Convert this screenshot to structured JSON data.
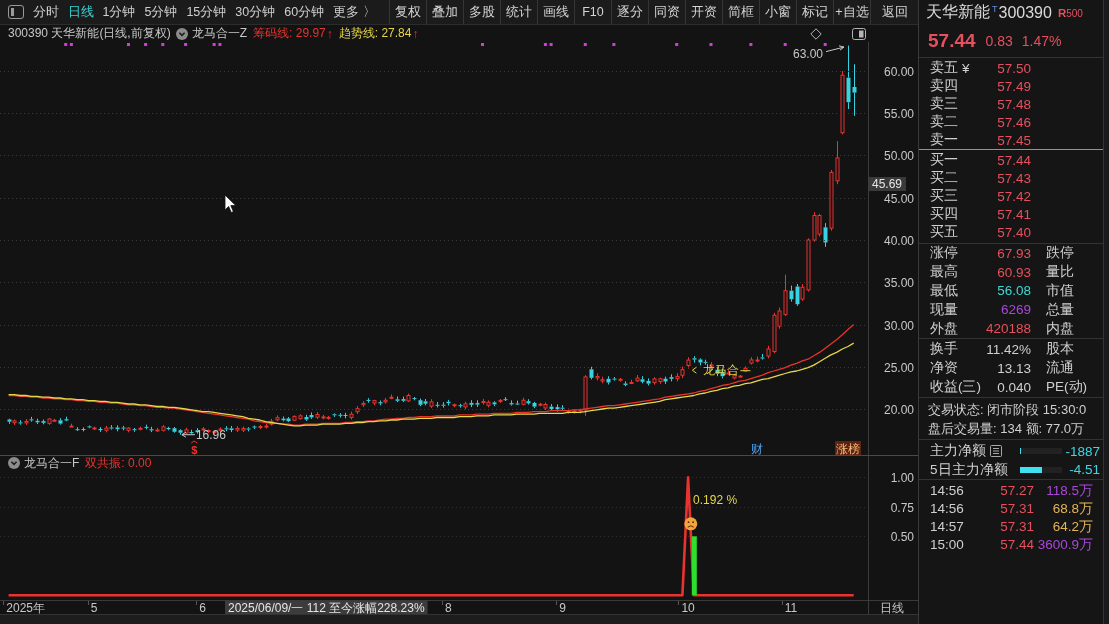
{
  "toolbar": {
    "tabs": [
      {
        "label": "分时",
        "selected": false
      },
      {
        "label": "日线",
        "selected": true
      },
      {
        "label": "1分钟",
        "selected": false
      },
      {
        "label": "5分钟",
        "selected": false
      },
      {
        "label": "15分钟",
        "selected": false
      },
      {
        "label": "30分钟",
        "selected": false
      },
      {
        "label": "60分钟",
        "selected": false
      },
      {
        "label": "更多 〉",
        "selected": false
      }
    ],
    "buttons": [
      "复权",
      "叠加",
      "多股",
      "统计",
      "画线",
      "F10",
      "逐分",
      "同资",
      "开资",
      "简框",
      "小窗",
      "标记",
      "+自选"
    ],
    "back": "返回"
  },
  "chart_header": {
    "title": "300390 天华新能(日线,前复权)",
    "indicator": "龙马合一Z",
    "legend": [
      {
        "label": "筹码线:",
        "value": "29.97",
        "arrow": "↑",
        "color": "#e8332e"
      },
      {
        "label": "趋势线:",
        "value": "27.84",
        "arrow": "↑",
        "color": "#e6d64a"
      }
    ]
  },
  "price_chart": {
    "cursor_value": "45.69",
    "high_label": "63.00",
    "low_label": "16.96",
    "signal_label": "龙马合",
    "event_marks": [
      {
        "kind": "dividend",
        "text": "$"
      },
      {
        "kind": "finance",
        "text": "财"
      },
      {
        "kind": "rank",
        "text": "涨榜"
      }
    ],
    "chart_data": {
      "type": "line",
      "grid": true,
      "categories": [
        null,
        null,
        null,
        null,
        null,
        null,
        null,
        null,
        null,
        null,
        null,
        null,
        null,
        null,
        null,
        null,
        null,
        null,
        null,
        null,
        null,
        null,
        null,
        null,
        null,
        null,
        null,
        null,
        null,
        null,
        null,
        null,
        null,
        null,
        null,
        null,
        null,
        null,
        null,
        null,
        null,
        null,
        null,
        null,
        null,
        null,
        null,
        null,
        null,
        null,
        null,
        null,
        null,
        null,
        null,
        null,
        null,
        null,
        null,
        null,
        null,
        null,
        null,
        null,
        null,
        null,
        null,
        null,
        null,
        null,
        null,
        null,
        null,
        null,
        null,
        null,
        null,
        null,
        null,
        null,
        null,
        null,
        null,
        null,
        null,
        null,
        null,
        null,
        null,
        null,
        null,
        null,
        null,
        null,
        null,
        null,
        null,
        null,
        null,
        null,
        null,
        null,
        null,
        null,
        null,
        null,
        null,
        null,
        null,
        null,
        null,
        null,
        null,
        null,
        null,
        null,
        null,
        null,
        null,
        null,
        null,
        null,
        null,
        null,
        null,
        null,
        null,
        null,
        null,
        null,
        null,
        null,
        null,
        null,
        null,
        null,
        null,
        null,
        null,
        null,
        null,
        null,
        null,
        null,
        null,
        null,
        null,
        null,
        null,
        null,
        null,
        null
      ],
      "ylim": [
        14.56,
        63.43
      ],
      "yticks": [
        {
          "value": 20,
          "label": "20.00"
        },
        {
          "value": 25,
          "label": "25.00"
        },
        {
          "value": 30,
          "label": "30.00"
        },
        {
          "value": 35,
          "label": "35.00"
        },
        {
          "value": 40,
          "label": "40.00"
        },
        {
          "value": 45,
          "label": "45.00"
        },
        {
          "value": 50,
          "label": "50.00"
        },
        {
          "value": 55,
          "label": "55.00"
        },
        {
          "value": 60,
          "label": "60.00"
        }
      ],
      "series": [
        {
          "color": "#e8332e",
          "values": [
            null,
            21.6,
            21.6,
            21.5,
            21.5,
            21.4,
            21.4,
            21.3,
            21.3,
            21.2,
            21.2,
            21.1,
            21.1,
            21.0,
            21.0,
            20.9,
            20.9,
            20.8,
            20.8,
            20.7,
            20.7,
            20.6,
            20.5,
            20.5,
            20.4,
            20.4,
            20.3,
            20.2,
            20.2,
            20.1,
            20.1,
            20.0,
            19.9,
            19.8,
            19.7,
            19.6,
            19.5,
            19.4,
            19.3,
            19.2,
            19.1,
            19.0,
            18.9,
            18.8,
            18.6,
            18.5,
            18.4,
            18.3,
            18.3,
            18.2,
            18.2,
            18.1,
            18.1,
            18.2,
            18.2,
            18.2,
            18.3,
            18.3,
            18.3,
            18.3,
            18.4,
            18.4,
            18.5,
            18.5,
            18.6,
            18.6,
            18.7,
            18.8,
            18.8,
            18.9,
            18.9,
            19.0,
            19.0,
            19.1,
            19.1,
            19.1,
            19.2,
            19.2,
            19.2,
            19.2,
            19.3,
            19.3,
            19.3,
            19.4,
            19.4,
            19.4,
            19.5,
            19.5,
            19.5,
            19.5,
            19.6,
            19.6,
            19.6,
            19.7,
            19.7,
            19.7,
            19.8,
            19.8,
            19.8,
            19.8,
            19.9,
            19.9,
            20.0,
            20.1,
            20.2,
            20.3,
            20.4,
            20.4,
            20.5,
            20.6,
            20.7,
            20.8,
            20.9,
            21.0,
            21.1,
            21.2,
            21.4,
            21.5,
            21.6,
            21.7,
            21.8,
            21.9,
            22.1,
            22.2,
            22.4,
            22.6,
            22.8,
            22.9,
            23.1,
            23.3,
            23.4,
            23.6,
            23.8,
            24.0,
            24.3,
            24.5,
            24.7,
            24.9,
            25.2,
            25.4,
            25.7,
            25.9,
            26.3,
            26.7,
            27.2,
            27.7,
            28.2,
            28.8,
            29.4,
            30.0,
            null,
            null
          ]
        },
        {
          "color": "#e6d64a",
          "values": [
            null,
            21.7,
            21.7,
            21.6,
            21.6,
            21.5,
            21.5,
            21.4,
            21.4,
            21.3,
            21.3,
            21.2,
            21.2,
            21.1,
            21.1,
            21.0,
            21.0,
            20.9,
            20.9,
            20.8,
            20.8,
            20.7,
            20.6,
            20.6,
            20.5,
            20.5,
            20.4,
            20.3,
            20.3,
            20.2,
            20.2,
            20.1,
            20.0,
            19.9,
            19.8,
            19.7,
            19.7,
            19.6,
            19.5,
            19.4,
            19.3,
            19.2,
            19.1,
            18.9,
            18.8,
            18.7,
            18.5,
            18.4,
            18.3,
            18.2,
            18.1,
            18.0,
            18.0,
            18.1,
            18.1,
            18.1,
            18.2,
            18.2,
            18.2,
            18.2,
            18.3,
            18.3,
            18.4,
            18.4,
            18.5,
            18.5,
            18.6,
            18.6,
            18.7,
            18.7,
            18.8,
            18.8,
            18.8,
            18.9,
            18.9,
            18.9,
            19.0,
            19.0,
            19.0,
            19.0,
            19.1,
            19.1,
            19.1,
            19.2,
            19.2,
            19.2,
            19.3,
            19.3,
            19.3,
            19.3,
            19.4,
            19.4,
            19.4,
            19.4,
            19.5,
            19.5,
            19.5,
            19.5,
            19.5,
            19.6,
            19.6,
            19.6,
            19.7,
            19.8,
            19.9,
            20.0,
            20.1,
            20.1,
            20.2,
            20.3,
            20.4,
            20.5,
            20.6,
            20.7,
            20.8,
            20.9,
            21.1,
            21.2,
            21.3,
            21.4,
            21.5,
            21.6,
            21.8,
            21.9,
            22.1,
            22.2,
            22.4,
            22.5,
            22.7,
            22.8,
            23.0,
            23.1,
            23.3,
            23.5,
            23.6,
            23.8,
            24.0,
            24.2,
            24.4,
            24.5,
            24.7,
            24.9,
            25.2,
            25.6,
            26.0,
            26.4,
            26.7,
            27.1,
            27.4,
            27.8,
            null,
            null
          ]
        }
      ]
    }
  },
  "indicator": {
    "title": "龙马合一F",
    "reading": "双共振: 0.00",
    "cursor_date": "2025/06/09/一 112 至今涨幅228.23%",
    "period": "日线",
    "chart_data": {
      "type": "line",
      "grid": true,
      "categories": [
        null,
        null,
        null,
        null,
        "2025年",
        null,
        null,
        null,
        null,
        null,
        null,
        null,
        null,
        null,
        null,
        null,
        "5",
        null,
        null,
        null,
        null,
        null,
        null,
        null,
        null,
        null,
        null,
        null,
        null,
        null,
        null,
        null,
        null,
        null,
        null,
        "6",
        null,
        null,
        null,
        null,
        null,
        null,
        null,
        null,
        null,
        null,
        null,
        null,
        null,
        null,
        null,
        null,
        null,
        null,
        null,
        null,
        null,
        null,
        null,
        null,
        null,
        null,
        null,
        null,
        null,
        null,
        null,
        null,
        null,
        null,
        null,
        null,
        null,
        null,
        null,
        null,
        null,
        null,
        "8",
        null,
        null,
        null,
        null,
        null,
        null,
        null,
        null,
        null,
        null,
        null,
        null,
        null,
        null,
        null,
        null,
        null,
        null,
        null,
        "9",
        null,
        null,
        null,
        null,
        null,
        null,
        null,
        null,
        null,
        null,
        null,
        null,
        null,
        null,
        null,
        null,
        null,
        null,
        null,
        null,
        null,
        "10",
        null,
        null,
        null,
        null,
        null,
        null,
        null,
        null,
        null,
        null,
        null,
        null,
        null,
        null,
        null,
        null,
        null,
        "11",
        null,
        null,
        null,
        null,
        null,
        null,
        null,
        null,
        null,
        null,
        null,
        null,
        null
      ],
      "ylim": [
        -0.04,
        1.18
      ],
      "yticks": [
        {
          "value": 0.5,
          "label": "0.50"
        },
        {
          "value": 0.75,
          "label": "0.75"
        },
        {
          "value": 1,
          "label": "1.00"
        }
      ],
      "series": [
        {
          "color": "#e8332e",
          "values": [
            null,
            0,
            0,
            0,
            0,
            0,
            0,
            0,
            0,
            0,
            0,
            0,
            0,
            0,
            0,
            0,
            0,
            0,
            0,
            0,
            0,
            0,
            0,
            0,
            0,
            0,
            0,
            0,
            0,
            0,
            0,
            0,
            0,
            0,
            0,
            0,
            0,
            0,
            0,
            0,
            0,
            0,
            0,
            0,
            0,
            0,
            0,
            0,
            0,
            0,
            0,
            0,
            0,
            0,
            0,
            0,
            0,
            0,
            0,
            0,
            0,
            0,
            0,
            0,
            0,
            0,
            0,
            0,
            0,
            0,
            0,
            0,
            0,
            0,
            0,
            0,
            0,
            0,
            0,
            0,
            0,
            0,
            0,
            0,
            0,
            0,
            0,
            0,
            0,
            0,
            0,
            0,
            0,
            0,
            0,
            0,
            0,
            0,
            0,
            0,
            0,
            0,
            0,
            0,
            0,
            0,
            0,
            0,
            0,
            0,
            0,
            0,
            0,
            0,
            0,
            0,
            0,
            0,
            0,
            0,
            1,
            0,
            0,
            0,
            0,
            0,
            0,
            0,
            0,
            0,
            0,
            0,
            0,
            0,
            0,
            0,
            0,
            0,
            0,
            0,
            0,
            0,
            0,
            0,
            0,
            0,
            0,
            0,
            0,
            0,
            null,
            null
          ]
        }
      ],
      "annotations": [
        "0.192 %"
      ]
    }
  },
  "quote": {
    "name": "天华新能",
    "tag": "T",
    "code": "300390",
    "rank": "**R**500",
    "price": "57.44",
    "change": "0.83",
    "change_pct": "1.47%",
    "asks": [
      {
        "label": "卖五",
        "mark": "¥",
        "price": "57.50"
      },
      {
        "label": "卖四",
        "price": "57.49"
      },
      {
        "label": "卖三",
        "price": "57.48"
      },
      {
        "label": "卖二",
        "price": "57.46"
      },
      {
        "label": "卖一",
        "price": "57.45"
      }
    ],
    "bids": [
      {
        "label": "买一",
        "price": "57.44"
      },
      {
        "label": "买二",
        "price": "57.43"
      },
      {
        "label": "买三",
        "price": "57.42"
      },
      {
        "label": "买四",
        "price": "57.41"
      },
      {
        "label": "买五",
        "price": "57.40"
      }
    ],
    "stats": [
      {
        "label": "涨停",
        "value": "67.93",
        "color": "#e5505e",
        "label_2": "跌停"
      },
      {
        "label": "最高",
        "value": "60.93",
        "color": "#e5505e",
        "label_2": "量比"
      },
      {
        "label": "最低",
        "value": "56.08",
        "color": "#3fd6d6",
        "label_2": "市值"
      },
      {
        "label": "现量",
        "value": "6269",
        "color": "#a948d8",
        "label_2": "总量"
      },
      {
        "label": "外盘",
        "value": "420188",
        "color": "#e5505e",
        "label_2": "内盘"
      }
    ],
    "fundamentals": [
      {
        "label": "换手",
        "value": "11.42%",
        "label_2": "股本"
      },
      {
        "label": "净资",
        "value": "13.13",
        "label_2": "流通"
      },
      {
        "label": "收益(三)",
        "value": "0.040",
        "label_2": "PE(动)"
      }
    ],
    "session": [
      "交易状态: 闭市阶段 15:30:0",
      "盘后交易量: 134 额: 77.0万"
    ],
    "flows": [
      {
        "kind": "daily",
        "label": "主力净额",
        "level": 0.03,
        "value": "-1887"
      },
      {
        "kind": "multi_day",
        "label": "5日主力净额",
        "level": 0.52,
        "value": "-4.51"
      }
    ],
    "ticks": [
      {
        "time": "14:56",
        "price": "57.27",
        "volume": "118.5万",
        "color": "#a948d8"
      },
      {
        "time": "14:56",
        "price": "57.31",
        "volume": "68.8万",
        "color": "#e3b45a"
      },
      {
        "time": "14:57",
        "price": "57.31",
        "volume": "64.2万",
        "color": "#e3b45a"
      },
      {
        "time": "15:00",
        "price": "57.44",
        "volume": "3600.9万",
        "color": "#a948d8"
      }
    ]
  }
}
